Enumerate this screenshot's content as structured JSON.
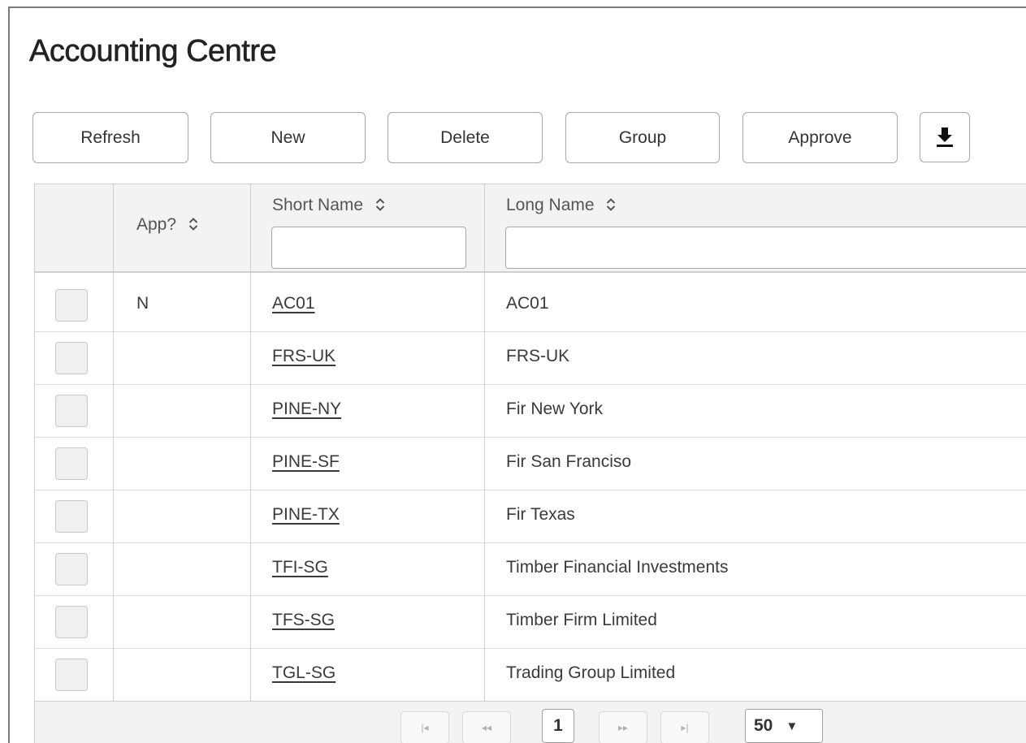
{
  "page": {
    "title": "Accounting Centre"
  },
  "toolbar": {
    "refresh_label": "Refresh",
    "new_label": "New",
    "delete_label": "Delete",
    "group_label": "Group",
    "approve_label": "Approve",
    "download_icon": "download-icon"
  },
  "grid": {
    "columns": [
      {
        "label": "",
        "sortable": false
      },
      {
        "label": "App?",
        "sortable": true
      },
      {
        "label": "Short Name",
        "sortable": true,
        "filter_value": ""
      },
      {
        "label": "Long Name",
        "sortable": true,
        "filter_value": ""
      }
    ],
    "rows": [
      {
        "app": "N",
        "short_name": "AC01",
        "long_name": "AC01"
      },
      {
        "app": "",
        "short_name": "FRS-UK",
        "long_name": "FRS-UK"
      },
      {
        "app": "",
        "short_name": "PINE-NY",
        "long_name": "Fir New York"
      },
      {
        "app": "",
        "short_name": "PINE-SF",
        "long_name": "Fir San Franciso"
      },
      {
        "app": "",
        "short_name": "PINE-TX",
        "long_name": "Fir Texas"
      },
      {
        "app": "",
        "short_name": "TFI-SG",
        "long_name": "Timber Financial Investments"
      },
      {
        "app": "",
        "short_name": "TFS-SG",
        "long_name": "Timber Firm Limited"
      },
      {
        "app": "",
        "short_name": "TGL-SG",
        "long_name": "Trading Group Limited"
      }
    ]
  },
  "pagination": {
    "first_icon": "|◂",
    "prev_icon": "◂◂",
    "current_page": "1",
    "next_icon": "▸▸",
    "last_icon": "▸|",
    "page_size": "50",
    "page_size_caret": "▼"
  },
  "colors": {
    "header_bg": "#f3f3f3",
    "border": "#cfcfcf",
    "text": "#333333"
  }
}
